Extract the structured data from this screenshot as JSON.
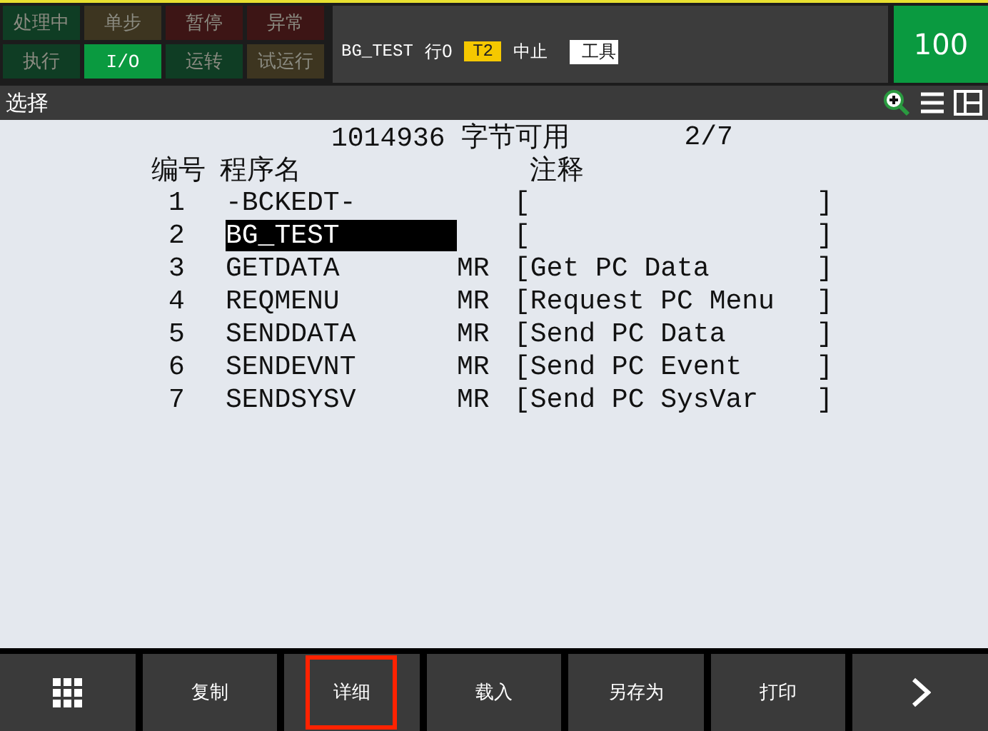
{
  "lamps": [
    {
      "label": "处理中",
      "on": false,
      "color": "#0f3d24"
    },
    {
      "label": "单步",
      "on": false,
      "color": "#3d3520"
    },
    {
      "label": "暂停",
      "on": false,
      "color": "#3d1515"
    },
    {
      "label": "异常",
      "on": false,
      "color": "#3d1515"
    },
    {
      "label": "执行",
      "on": false,
      "color": "#0f3d24"
    },
    {
      "label": "I/O",
      "on": true,
      "color": "#0a9a40"
    },
    {
      "label": "运转",
      "on": false,
      "color": "#0f3d24"
    },
    {
      "label": "试运行",
      "on": false,
      "color": "#3d3520"
    }
  ],
  "status": {
    "program": "BG_TEST",
    "line": "行0",
    "mode": "T2",
    "state": "中止",
    "tool": "工具"
  },
  "override": "100",
  "title": "选择",
  "header": {
    "memory": "1014936 字节可用",
    "page": "2/7"
  },
  "columns": [
    "编号",
    "程序名",
    "注释"
  ],
  "rows": [
    {
      "no": "1",
      "name": "-BCKEDT-",
      "comment": "[",
      "close": "]",
      "selected": false
    },
    {
      "no": "2",
      "name": "BG_TEST",
      "comment": "[",
      "close": "]",
      "selected": true
    },
    {
      "no": "3",
      "name": "GETDATA",
      "type": "MR",
      "comment": "[Get PC Data",
      "close": "]",
      "selected": false
    },
    {
      "no": "4",
      "name": "REQMENU",
      "type": "MR",
      "comment": "[Request PC Menu",
      "close": "]",
      "selected": false
    },
    {
      "no": "5",
      "name": "SENDDATA",
      "type": "MR",
      "comment": "[Send PC Data",
      "close": "]",
      "selected": false
    },
    {
      "no": "6",
      "name": "SENDEVNT",
      "type": "MR",
      "comment": "[Send PC Event",
      "close": "]",
      "selected": false
    },
    {
      "no": "7",
      "name": "SENDSYSV",
      "type": "MR",
      "comment": "[Send PC SysVar",
      "close": "]",
      "selected": false
    }
  ],
  "softkeys": [
    {
      "kind": "menu"
    },
    {
      "kind": "text",
      "label": "复制",
      "highlighted": false
    },
    {
      "kind": "text",
      "label": "详细",
      "highlighted": true
    },
    {
      "kind": "text",
      "label": "载入",
      "highlighted": false
    },
    {
      "kind": "text",
      "label": "另存为",
      "highlighted": false
    },
    {
      "kind": "text",
      "label": "打印",
      "highlighted": false
    },
    {
      "kind": "next"
    }
  ]
}
